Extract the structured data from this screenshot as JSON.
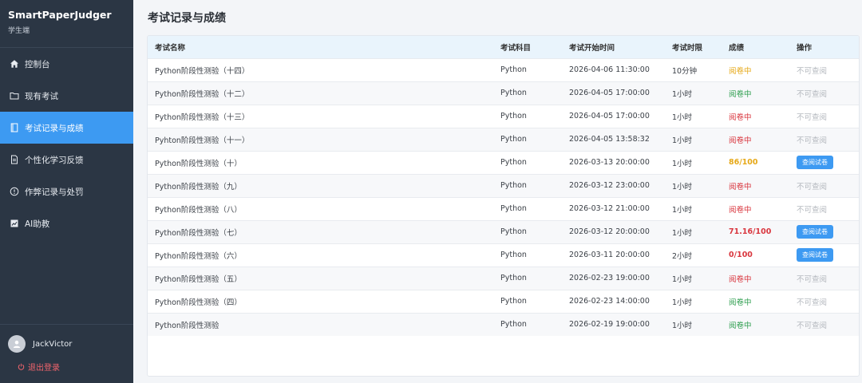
{
  "brand": {
    "title": "SmartPaperJudger",
    "subtitle": "学生端"
  },
  "menu": [
    {
      "label": "控制台",
      "icon": "home-icon",
      "active": false
    },
    {
      "label": "现有考试",
      "icon": "folder-icon",
      "active": false
    },
    {
      "label": "考试记录与成绩",
      "icon": "notebook-icon",
      "active": true
    },
    {
      "label": "个性化学习反馈",
      "icon": "document-icon",
      "active": false
    },
    {
      "label": "作弊记录与处罚",
      "icon": "alert-circle-icon",
      "active": false
    },
    {
      "label": "AI助教",
      "icon": "chart-icon",
      "active": false
    }
  ],
  "user": {
    "name": "JackVictor",
    "logout_label": "退出登录"
  },
  "page": {
    "title": "考试记录与成绩"
  },
  "table": {
    "headers": [
      "考试名称",
      "考试科目",
      "考试开始时间",
      "考试时限",
      "成绩",
      "操作"
    ],
    "rows": [
      {
        "name": "Python阶段性测验（十四）",
        "subject": "Python",
        "start": "2026-04-06 11:30:00",
        "limit": "10分钟",
        "score": "阅卷中",
        "score_style": "st-yellow",
        "action": "不可查阅",
        "action_type": "text"
      },
      {
        "name": "Python阶段性测验（十二）",
        "subject": "Python",
        "start": "2026-04-05 17:00:00",
        "limit": "1小时",
        "score": "阅卷中",
        "score_style": "st-green",
        "action": "不可查阅",
        "action_type": "text"
      },
      {
        "name": "Python阶段性测验（十三）",
        "subject": "Python",
        "start": "2026-04-05 17:00:00",
        "limit": "1小时",
        "score": "阅卷中",
        "score_style": "st-red",
        "action": "不可查阅",
        "action_type": "text"
      },
      {
        "name": "Pyhton阶段性测验（十一）",
        "subject": "Python",
        "start": "2026-04-05 13:58:32",
        "limit": "1小时",
        "score": "阅卷中",
        "score_style": "st-red",
        "action": "不可查阅",
        "action_type": "text"
      },
      {
        "name": "Python阶段性测验（十）",
        "subject": "Python",
        "start": "2026-03-13 20:00:00",
        "limit": "1小时",
        "score": "86/100",
        "score_style": "score-yellow",
        "action": "查阅试卷",
        "action_type": "button"
      },
      {
        "name": "Python阶段性测验（九）",
        "subject": "Python",
        "start": "2026-03-12 23:00:00",
        "limit": "1小时",
        "score": "阅卷中",
        "score_style": "st-red",
        "action": "不可查阅",
        "action_type": "text"
      },
      {
        "name": "Python阶段性测验（八）",
        "subject": "Python",
        "start": "2026-03-12 21:00:00",
        "limit": "1小时",
        "score": "阅卷中",
        "score_style": "st-red",
        "action": "不可查阅",
        "action_type": "text"
      },
      {
        "name": "Python阶段性测验（七）",
        "subject": "Python",
        "start": "2026-03-12 20:00:00",
        "limit": "1小时",
        "score": "71.16/100",
        "score_style": "score-red",
        "action": "查阅试卷",
        "action_type": "button"
      },
      {
        "name": "Python阶段性测验（六）",
        "subject": "Python",
        "start": "2026-03-11 20:00:00",
        "limit": "2小时",
        "score": "0/100",
        "score_style": "score-red",
        "action": "查阅试卷",
        "action_type": "button"
      },
      {
        "name": "Python阶段性测验（五）",
        "subject": "Python",
        "start": "2026-02-23 19:00:00",
        "limit": "1小时",
        "score": "阅卷中",
        "score_style": "st-red",
        "action": "不可查阅",
        "action_type": "text"
      },
      {
        "name": "Python阶段性测验（四）",
        "subject": "Python",
        "start": "2026-02-23 14:00:00",
        "limit": "1小时",
        "score": "阅卷中",
        "score_style": "st-green",
        "action": "不可查阅",
        "action_type": "text"
      },
      {
        "name": "Python阶段性测验",
        "subject": "Python",
        "start": "2026-02-19 19:00:00",
        "limit": "1小时",
        "score": "阅卷中",
        "score_style": "st-green",
        "action": "不可查阅",
        "action_type": "text"
      }
    ]
  }
}
